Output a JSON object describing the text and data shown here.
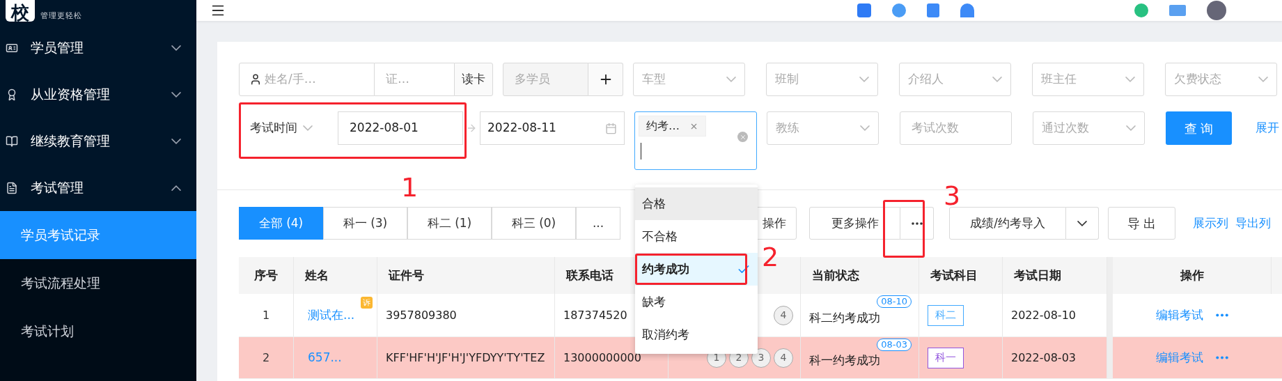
{
  "sidebar": {
    "logo": {
      "mark": "校",
      "tagline": "管理更轻松"
    },
    "items": [
      {
        "kind": "group",
        "label": "学员管理",
        "expanded": false
      },
      {
        "kind": "group",
        "label": "从业资格管理",
        "expanded": false
      },
      {
        "kind": "group",
        "label": "继续教育管理",
        "expanded": false
      },
      {
        "kind": "group",
        "label": "考试管理",
        "expanded": true
      },
      {
        "kind": "link",
        "label": "学员考试记录",
        "selected": true
      },
      {
        "kind": "link",
        "label": "考试流程处理",
        "selected": false
      },
      {
        "kind": "link",
        "label": "考试计划",
        "selected": false
      }
    ]
  },
  "filters": {
    "name_field": {
      "placeholder": "姓名/手…"
    },
    "id_field": {
      "placeholder": "证…"
    },
    "read_card_button": "读卡",
    "multi_student": {
      "placeholder": "多学员"
    },
    "selects": [
      {
        "placeholder": "车型"
      },
      {
        "placeholder": "班制"
      },
      {
        "placeholder": "介绍人"
      },
      {
        "placeholder": "班主任"
      },
      {
        "placeholder": "欠费状态"
      }
    ],
    "date_range": {
      "type_select": "考试时间",
      "start": "2022-08-01",
      "end": "2022-08-11"
    },
    "status_select": {
      "tags": [
        "约考…"
      ]
    },
    "row2_fields": [
      {
        "kind": "select",
        "placeholder": "教练"
      },
      {
        "kind": "input",
        "placeholder": "考试次数"
      },
      {
        "kind": "select",
        "placeholder": "通过次数"
      }
    ],
    "query_button": "查 询",
    "expand_link": "展开"
  },
  "tabs": [
    {
      "label": "全部 (4)",
      "selected": true
    },
    {
      "label": "科一 (3)",
      "selected": false
    },
    {
      "label": "科二 (1)",
      "selected": false
    },
    {
      "label": "科三 (0)",
      "selected": false
    },
    {
      "label": "...",
      "selected": false
    }
  ],
  "toolbar": {
    "partial_button": "操作",
    "more_button": "更多操作",
    "import_button": "成绩/约考导入",
    "export_button": "导 出",
    "links": [
      "展示列",
      "导出列"
    ]
  },
  "dropdown": {
    "options": [
      {
        "label": "合格",
        "selected": false,
        "highlighted": true
      },
      {
        "label": "不合格",
        "selected": false,
        "highlighted": false
      },
      {
        "label": "约考成功",
        "selected": true,
        "highlighted": false
      },
      {
        "label": "缺考",
        "selected": false,
        "highlighted": false
      },
      {
        "label": "取消约考",
        "selected": false,
        "highlighted": false
      }
    ]
  },
  "table": {
    "columns": [
      "序号",
      "姓名",
      "证件号",
      "联系电话",
      "当前状态",
      "考试科目",
      "考试日期",
      "操作"
    ],
    "rows": [
      {
        "index": "1",
        "name": "测试在...",
        "badge": "诉",
        "id": "3957809380",
        "phone": "187374520",
        "progress": [
          "4"
        ],
        "status": "科二约考成功",
        "status_date": "08-10",
        "subject": "科二",
        "color": "#40a9ff",
        "date": "2022-08-10",
        "action": "编辑考试",
        "highlighted": false
      },
      {
        "index": "2",
        "name": "657...",
        "id": "KFF'HF'H'JF'H'J'YFDYY'TY'TEZ",
        "phone": "13000000000",
        "progress": [
          "1",
          "2",
          "3",
          "4"
        ],
        "status": "科一约考成功",
        "status_date": "08-03",
        "subject": "科一",
        "color": "#9254de",
        "date": "2022-08-03",
        "action": "编辑考试",
        "highlighted": true
      }
    ]
  },
  "annotations": [
    {
      "label": "1"
    },
    {
      "label": "2"
    },
    {
      "label": "3"
    }
  ]
}
